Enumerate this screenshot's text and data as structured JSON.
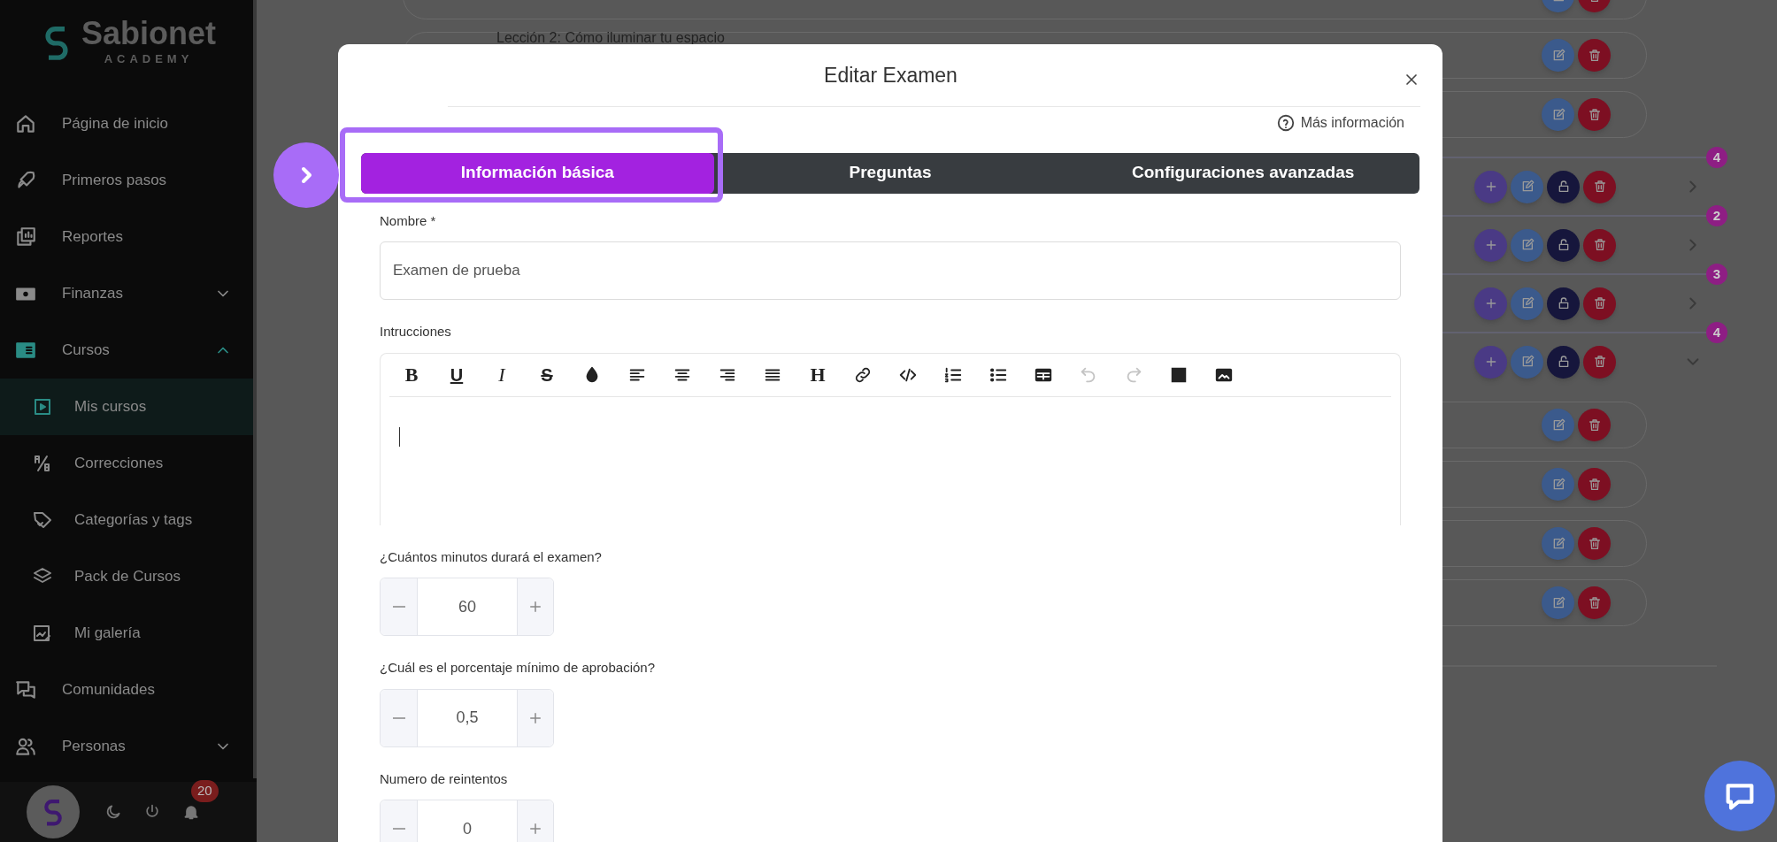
{
  "sidebar": {
    "logo": {
      "name": "Sabionet",
      "subtitle": "ACADEMY"
    },
    "items": [
      {
        "label": "Página de inicio",
        "selected": false
      },
      {
        "label": "Primeros pasos",
        "selected": false
      },
      {
        "label": "Reportes",
        "selected": false
      },
      {
        "label": "Finanzas",
        "selected": false,
        "expanded": false
      },
      {
        "label": "Cursos",
        "selected": false,
        "expanded": true,
        "children": [
          {
            "label": "Mis cursos",
            "selected": true
          },
          {
            "label": "Correcciones",
            "selected": false
          },
          {
            "label": "Categorías y tags",
            "selected": false
          },
          {
            "label": "Pack de Cursos",
            "selected": false
          },
          {
            "label": "Mi galería",
            "selected": false
          }
        ]
      },
      {
        "label": "Comunidades",
        "selected": false
      },
      {
        "label": "Personas",
        "selected": false,
        "expanded": false
      }
    ],
    "footer": {
      "notifications": "20"
    }
  },
  "background": {
    "rows": [
      {
        "kind": "lesson"
      },
      {
        "kind": "lesson",
        "title": "Lección 2: Cómo iluminar tu espacio"
      },
      {
        "kind": "lesson"
      },
      {
        "kind": "module",
        "count": "4",
        "expanded": false
      },
      {
        "kind": "module",
        "count": "2",
        "expanded": false
      },
      {
        "kind": "module",
        "count": "3",
        "expanded": false
      },
      {
        "kind": "module",
        "count": "4",
        "expanded": true
      },
      {
        "kind": "lesson"
      },
      {
        "kind": "lesson"
      },
      {
        "kind": "lesson"
      },
      {
        "kind": "lesson"
      }
    ]
  },
  "modal": {
    "title": "Editar Examen",
    "help": "Más información",
    "tabs": [
      {
        "label": "Información básica",
        "selected": true,
        "highlighted": true
      },
      {
        "label": "Preguntas",
        "selected": false,
        "highlighted": false
      },
      {
        "label": "Configuraciones avanzadas",
        "selected": false,
        "highlighted": false
      }
    ],
    "fields": [
      {
        "kind": "text",
        "label": "Nombre *",
        "value": "Examen de prueba"
      },
      {
        "kind": "editor",
        "label": "Intrucciones",
        "tools": [
          {
            "kind": "bold",
            "label": "B",
            "disabled": false
          },
          {
            "kind": "underline",
            "label": "U",
            "disabled": false
          },
          {
            "kind": "italic",
            "label": "I",
            "disabled": false
          },
          {
            "kind": "strike",
            "label": "S",
            "disabled": false
          },
          {
            "kind": "color",
            "disabled": false
          },
          {
            "kind": "align-left",
            "disabled": false
          },
          {
            "kind": "align-center",
            "disabled": false
          },
          {
            "kind": "align-right",
            "disabled": false
          },
          {
            "kind": "justify",
            "disabled": false
          },
          {
            "kind": "heading",
            "label": "H",
            "disabled": false
          },
          {
            "kind": "link",
            "disabled": false
          },
          {
            "kind": "code",
            "disabled": false
          },
          {
            "kind": "ordered-list",
            "disabled": false
          },
          {
            "kind": "bullet-list",
            "disabled": false
          },
          {
            "kind": "table",
            "disabled": false
          },
          {
            "kind": "undo",
            "disabled": true
          },
          {
            "kind": "redo",
            "disabled": true
          },
          {
            "kind": "block",
            "disabled": false
          },
          {
            "kind": "image",
            "disabled": false
          }
        ]
      },
      {
        "kind": "stepper",
        "label": "¿Cuántos minutos durará el examen?",
        "value": "60"
      },
      {
        "kind": "stepper",
        "label": "¿Cuál es el porcentaje mínimo de aprobación?",
        "value": "0,5"
      },
      {
        "kind": "stepper",
        "label": "Numero de reintentos",
        "value": "0"
      }
    ]
  }
}
